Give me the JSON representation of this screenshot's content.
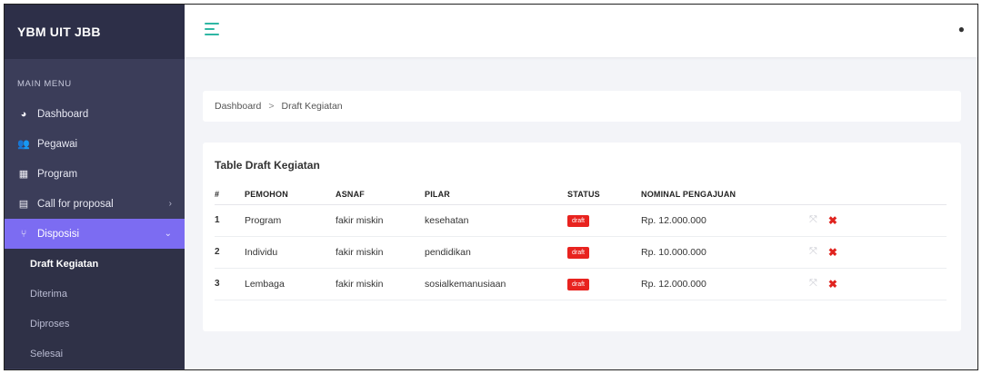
{
  "brand": "YBM UIT JBB",
  "sidebar": {
    "menu_title": "MAIN MENU",
    "items": [
      {
        "label": "Dashboard",
        "icon": "dashboard-icon"
      },
      {
        "label": "Pegawai",
        "icon": "users-icon"
      },
      {
        "label": "Program",
        "icon": "program-icon"
      },
      {
        "label": "Call for proposal",
        "icon": "proposal-icon"
      },
      {
        "label": "Disposisi",
        "icon": "disposisi-icon"
      }
    ],
    "submenu": [
      {
        "label": "Draft Kegiatan"
      },
      {
        "label": "Diterima"
      },
      {
        "label": "Diproses"
      },
      {
        "label": "Selesai"
      }
    ]
  },
  "breadcrumb": {
    "root": "Dashboard",
    "separator": ">",
    "current": "Draft Kegiatan"
  },
  "table": {
    "title": "Table Draft Kegiatan",
    "headers": [
      "#",
      "PEMOHON",
      "ASNAF",
      "PILAR",
      "STATUS",
      "NOMINAL PENGAJUAN"
    ],
    "rows": [
      {
        "no": "1",
        "pemohon": "Program",
        "asnaf": "fakir miskin",
        "pilar": "kesehatan",
        "status": "draft",
        "nominal": "Rp. 12.000.000"
      },
      {
        "no": "2",
        "pemohon": "Individu",
        "asnaf": "fakir miskin",
        "pilar": "pendidikan",
        "status": "draft",
        "nominal": "Rp. 10.000.000"
      },
      {
        "no": "3",
        "pemohon": "Lembaga",
        "asnaf": "fakir miskin",
        "pilar": "sosialkemanusiaan",
        "status": "draft",
        "nominal": "Rp. 12.000.000"
      }
    ]
  },
  "colors": {
    "accent": "#7c6cf2",
    "sidebar": "#3b3d59",
    "badge": "#e8231f",
    "delete": "#e0241f"
  }
}
